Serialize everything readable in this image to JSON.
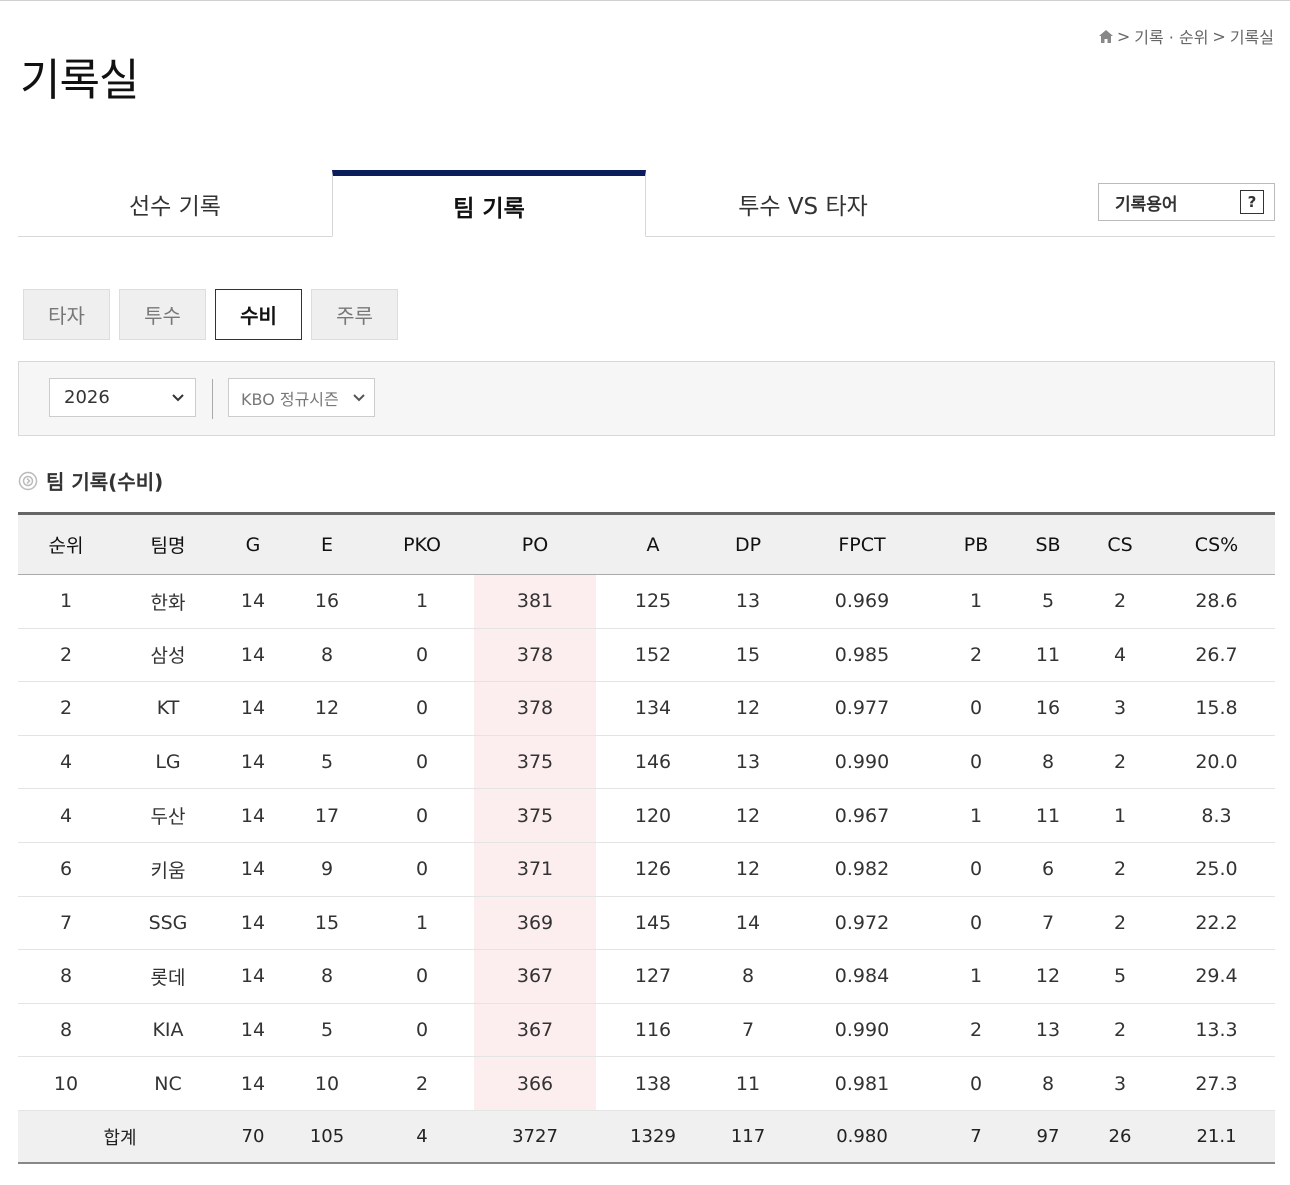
{
  "breadcrumb": {
    "items": [
      "기록 · 순위",
      "기록실"
    ],
    "separator": ">"
  },
  "page_title": "기록실",
  "main_tabs": [
    {
      "label": "선수 기록",
      "active": false
    },
    {
      "label": "팀 기록",
      "active": true
    },
    {
      "label": "투수 VS 타자",
      "active": false
    }
  ],
  "glossary": {
    "label": "기록용어",
    "help": "?"
  },
  "sub_tabs": [
    {
      "label": "타자",
      "active": false
    },
    {
      "label": "투수",
      "active": false
    },
    {
      "label": "수비",
      "active": true
    },
    {
      "label": "주루",
      "active": false
    }
  ],
  "filters": {
    "year": "2026",
    "series": "KBO 정규시즌"
  },
  "section_title": "팀 기록(수비)",
  "table": {
    "columns": [
      "순위",
      "팀명",
      "G",
      "E",
      "PKO",
      "PO",
      "A",
      "DP",
      "FPCT",
      "PB",
      "SB",
      "CS",
      "CS%"
    ],
    "sorted_column": "PO",
    "rows": [
      [
        "1",
        "한화",
        "14",
        "16",
        "1",
        "381",
        "125",
        "13",
        "0.969",
        "1",
        "5",
        "2",
        "28.6"
      ],
      [
        "2",
        "삼성",
        "14",
        "8",
        "0",
        "378",
        "152",
        "15",
        "0.985",
        "2",
        "11",
        "4",
        "26.7"
      ],
      [
        "2",
        "KT",
        "14",
        "12",
        "0",
        "378",
        "134",
        "12",
        "0.977",
        "0",
        "16",
        "3",
        "15.8"
      ],
      [
        "4",
        "LG",
        "14",
        "5",
        "0",
        "375",
        "146",
        "13",
        "0.990",
        "0",
        "8",
        "2",
        "20.0"
      ],
      [
        "4",
        "두산",
        "14",
        "17",
        "0",
        "375",
        "120",
        "12",
        "0.967",
        "1",
        "11",
        "1",
        "8.3"
      ],
      [
        "6",
        "키움",
        "14",
        "9",
        "0",
        "371",
        "126",
        "12",
        "0.982",
        "0",
        "6",
        "2",
        "25.0"
      ],
      [
        "7",
        "SSG",
        "14",
        "15",
        "1",
        "369",
        "145",
        "14",
        "0.972",
        "0",
        "7",
        "2",
        "22.2"
      ],
      [
        "8",
        "롯데",
        "14",
        "8",
        "0",
        "367",
        "127",
        "8",
        "0.984",
        "1",
        "12",
        "5",
        "29.4"
      ],
      [
        "8",
        "KIA",
        "14",
        "5",
        "0",
        "367",
        "116",
        "7",
        "0.990",
        "2",
        "13",
        "2",
        "13.3"
      ],
      [
        "10",
        "NC",
        "14",
        "10",
        "2",
        "366",
        "138",
        "11",
        "0.981",
        "0",
        "8",
        "3",
        "27.3"
      ]
    ],
    "total": {
      "label": "합계",
      "values": [
        "70",
        "105",
        "4",
        "3727",
        "1329",
        "117",
        "0.980",
        "7",
        "97",
        "26",
        "21.1"
      ]
    }
  },
  "colors": {
    "accent": "#0b1e5b",
    "sorted_column_bg": "#fcedef"
  }
}
